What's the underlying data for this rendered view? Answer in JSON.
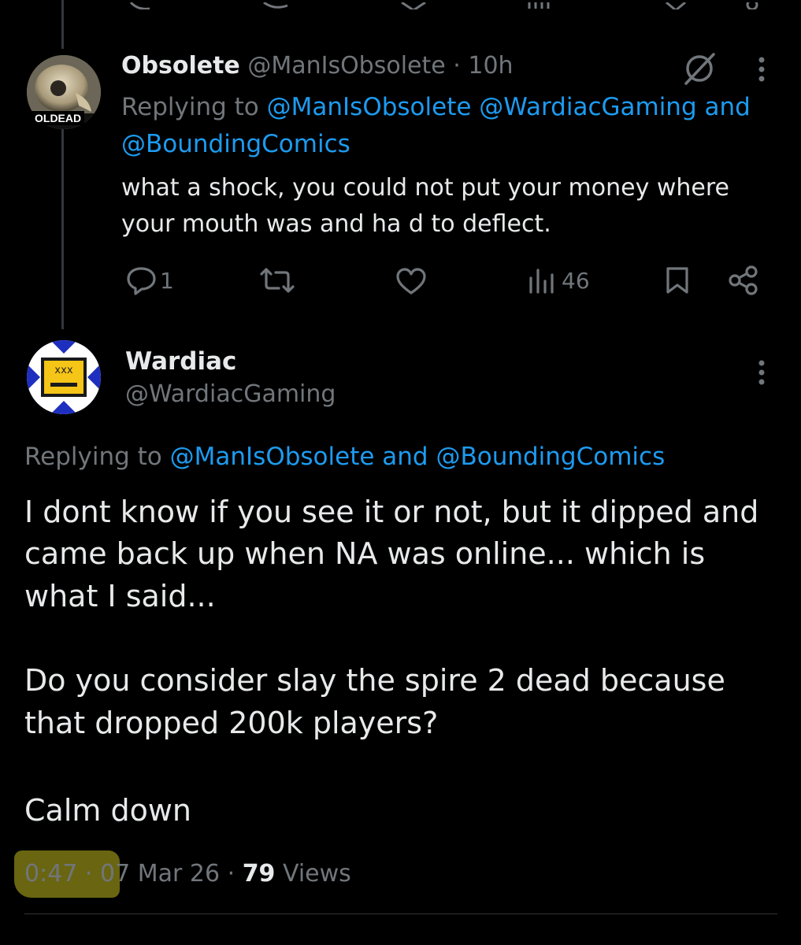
{
  "reply_tweet": {
    "author_name": "Obsolete",
    "author_handle": "@ManIsObsolete",
    "separator": "·",
    "age": "10h",
    "avatar_caption": "OLDEAD",
    "replying_prefix": "Replying to",
    "replying_handles_line1": "@ManIsObsolete @WardiacGaming and",
    "replying_handles_line2": "@BoundingComics",
    "body_line1": "what a shock, you could not put your money where",
    "body_line2": "your mouth was and ha d to deflect.",
    "reply_count": "1",
    "views_count": "46"
  },
  "main_tweet": {
    "author_name": "Wardiac",
    "author_handle": "@WardiacGaming",
    "replying_prefix": "Replying to",
    "replying_handles": "@ManIsObsolete and @BoundingComics",
    "body_line1": "I dont know if you see it or not, but it dipped and",
    "body_line2": "came back up when NA was online... which is",
    "body_line3": "what I said...",
    "body_line4": "Do you consider slay the spire 2 dead because",
    "body_line5": "that dropped 200k players?",
    "body_line6": "Calm down",
    "time": "0:47",
    "date": "07 Mar 26",
    "views_count": "79",
    "views_label": "Views",
    "separator": "·"
  },
  "colors": {
    "background": "#000000",
    "text": "#e7e9ea",
    "muted": "#71767b",
    "link": "#1d9bf0",
    "highlight": "#6f6a12"
  }
}
